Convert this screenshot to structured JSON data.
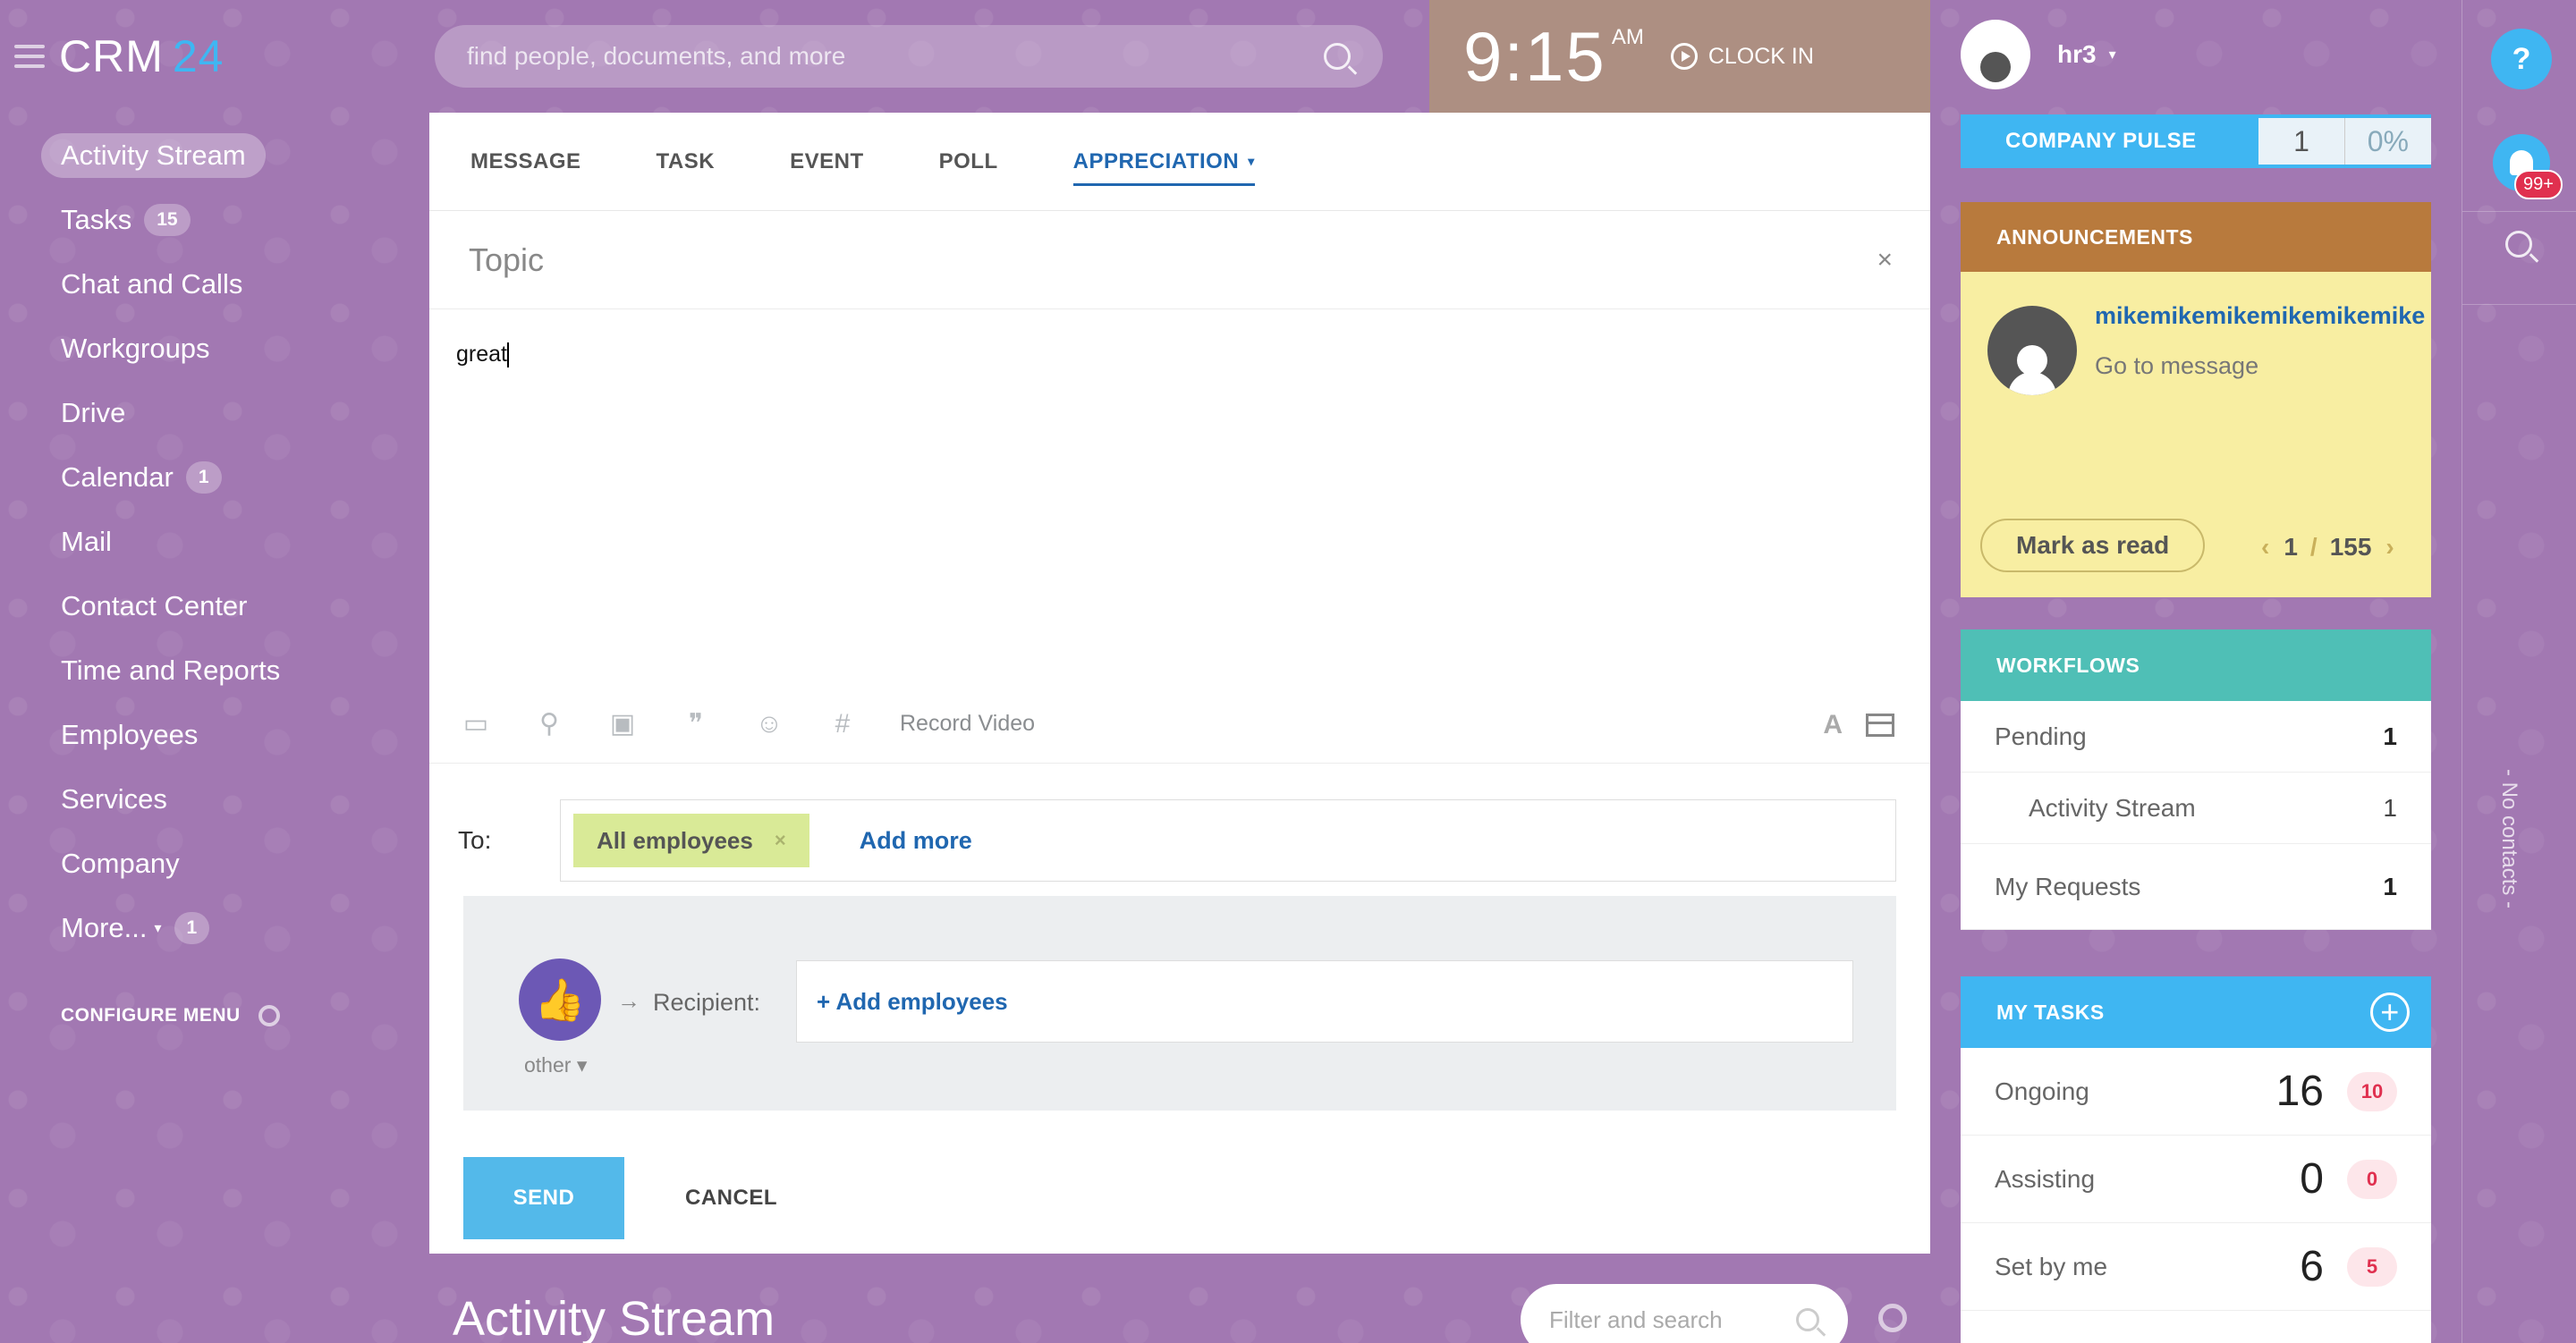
{
  "brand": {
    "name": "CRM",
    "number": "24"
  },
  "sidebar": {
    "items": [
      {
        "label": "Activity Stream",
        "badge": null
      },
      {
        "label": "Tasks",
        "badge": "15"
      },
      {
        "label": "Chat and Calls",
        "badge": null
      },
      {
        "label": "Workgroups",
        "badge": null
      },
      {
        "label": "Drive",
        "badge": null
      },
      {
        "label": "Calendar",
        "badge": "1"
      },
      {
        "label": "Mail",
        "badge": null
      },
      {
        "label": "Contact Center",
        "badge": null
      },
      {
        "label": "Time and Reports",
        "badge": null
      },
      {
        "label": "Employees",
        "badge": null
      },
      {
        "label": "Services",
        "badge": null
      },
      {
        "label": "Company",
        "badge": null
      },
      {
        "label": "More...",
        "badge": "1"
      }
    ],
    "configure_label": "CONFIGURE MENU"
  },
  "header": {
    "search_placeholder": "find people, documents, and more",
    "clock_time": "9:15",
    "clock_ampm": "AM",
    "clock_in_label": "CLOCK IN"
  },
  "composer": {
    "tabs": [
      "MESSAGE",
      "TASK",
      "EVENT",
      "POLL",
      "APPRECIATION"
    ],
    "active_tab": "APPRECIATION",
    "topic_placeholder": "Topic",
    "body_text": "great",
    "toolbar_record_video": "Record Video",
    "to_label": "To:",
    "recipient_chip": "All employees",
    "add_more": "Add more",
    "recipient_label": "Recipient:",
    "add_employees": "+ Add employees",
    "appreciation_type": "other",
    "send_label": "SEND",
    "cancel_label": "CANCEL"
  },
  "stream": {
    "title": "Activity Stream",
    "filter_placeholder": "Filter and search"
  },
  "user": {
    "name": "hr3"
  },
  "pulse": {
    "label": "COMPANY PULSE",
    "count": "1",
    "percent": "0%"
  },
  "announcements": {
    "header": "ANNOUNCEMENTS",
    "author": "mikemikemikemikemikemike",
    "link": "Go to message",
    "mark_read": "Mark as read",
    "page_current": "1",
    "page_sep": "/",
    "page_total": "155"
  },
  "workflows": {
    "header": "WORKFLOWS",
    "rows": [
      {
        "label": "Pending",
        "value": "1"
      },
      {
        "label": "Activity Stream",
        "value": "1"
      },
      {
        "label": "My Requests",
        "value": "1"
      }
    ]
  },
  "my_tasks": {
    "header": "MY TASKS",
    "rows": [
      {
        "label": "Ongoing",
        "count": "16",
        "badge": "10"
      },
      {
        "label": "Assisting",
        "count": "0",
        "badge": "0"
      },
      {
        "label": "Set by me",
        "count": "6",
        "badge": "5"
      }
    ]
  },
  "rail": {
    "help": "?",
    "notifications_badge": "99+",
    "no_contacts": "- No contacts -"
  },
  "colors": {
    "accent_blue": "#3fb6f2",
    "link_blue": "#2067b0",
    "announce_header": "#b87a3d",
    "workflows_header": "#4fbfb6",
    "background": "#a278b2"
  }
}
